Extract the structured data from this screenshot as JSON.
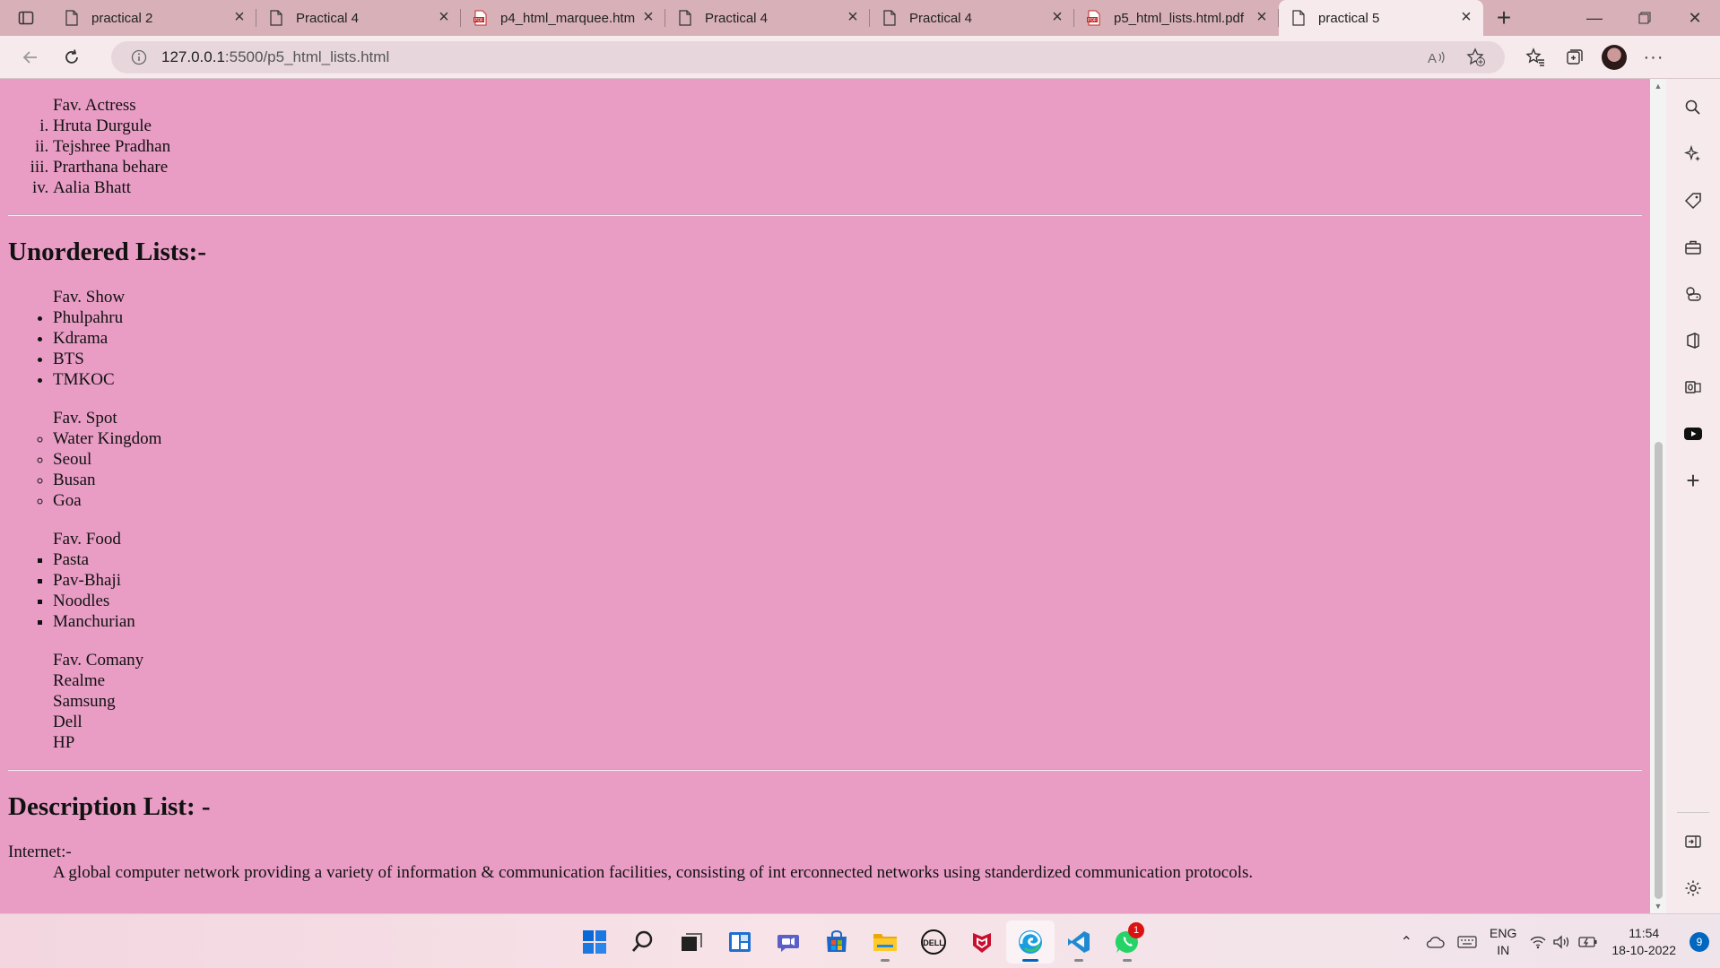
{
  "browser": {
    "tabs": [
      {
        "title": "practical 2",
        "icon": "page-icon",
        "active": false
      },
      {
        "title": "Practical 4",
        "icon": "page-icon",
        "active": false
      },
      {
        "title": "p4_html_marquee.htm",
        "icon": "pdf-icon",
        "active": false
      },
      {
        "title": "Practical 4",
        "icon": "page-icon",
        "active": false
      },
      {
        "title": "Practical 4",
        "icon": "page-icon",
        "active": false
      },
      {
        "title": "p5_html_lists.html.pdf",
        "icon": "pdf-icon",
        "active": false
      },
      {
        "title": "practical 5",
        "icon": "page-icon",
        "active": true
      }
    ],
    "url_host": "127.0.0.1",
    "url_path": ":5500/p5_html_lists.html"
  },
  "page": {
    "actress_caption": "Fav. Actress",
    "actresses": [
      "Hruta Durgule",
      "Tejshree Pradhan",
      "Prarthana behare",
      "Aalia Bhatt"
    ],
    "unordered_heading": "Unordered Lists:-",
    "show_caption": "Fav. Show",
    "shows": [
      "Phulpahru",
      "Kdrama",
      "BTS",
      "TMKOC"
    ],
    "spot_caption": "Fav. Spot",
    "spots": [
      "Water Kingdom",
      "Seoul",
      "Busan",
      "Goa"
    ],
    "food_caption": "Fav. Food",
    "foods": [
      "Pasta",
      "Pav-Bhaji",
      "Noodles",
      "Manchurian"
    ],
    "company_caption": "Fav. Comany",
    "companies": [
      "Realme",
      "Samsung",
      "Dell",
      "HP"
    ],
    "description_heading": "Description List: -",
    "term": "Internet:-",
    "definition": "A global computer network providing a variety of information & communication facilities, consisting of int erconnected networks using standerdized communication protocols."
  },
  "taskbar": {
    "apps": [
      "windows-start-icon",
      "search-icon",
      "task-view-icon",
      "widgets-icon",
      "teams-chat-icon",
      "microsoft-store-icon",
      "file-explorer-icon",
      "dell-icon",
      "mcafee-icon",
      "edge-icon",
      "vscode-icon",
      "whatsapp-icon"
    ],
    "whatsapp_badge": "1",
    "lang_top": "ENG",
    "lang_bottom": "IN",
    "time": "11:54",
    "date": "18-10-2022",
    "notifications": "9"
  },
  "colors": {
    "page_background": "#e99dc5",
    "tabstrip_background": "#d7b0b8",
    "toolbar_background": "#f6eaed"
  }
}
